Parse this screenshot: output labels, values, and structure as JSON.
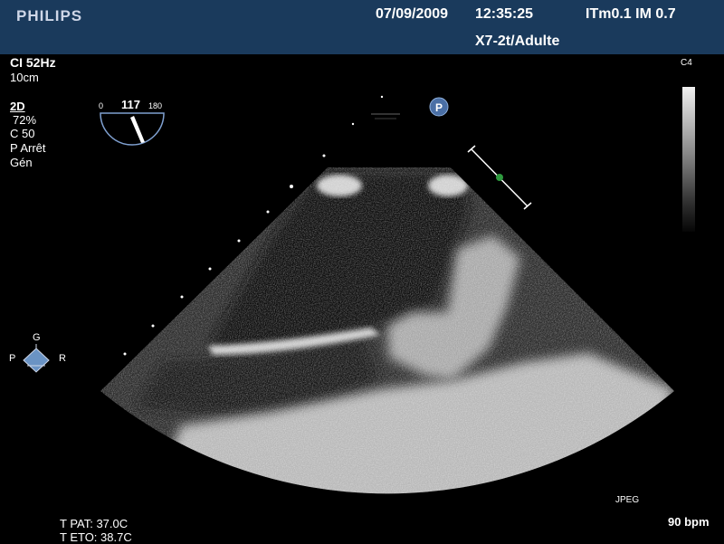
{
  "header": {
    "logo": "PHILIPS",
    "date": "07/09/2009",
    "time": "12:35:25",
    "index_values": "ITm0.1  IM 0.7",
    "probe_preset": "X7-2t/Adulte"
  },
  "left_panel": {
    "frame_rate": "CI 52Hz",
    "depth": "10cm",
    "mode": "2D",
    "gain": "72%",
    "compression": "C 50",
    "persistence": "P Arrêt",
    "frequency": "Gén"
  },
  "angle_indicator": {
    "min_label": "0",
    "max_label": "180",
    "value_label": "117",
    "angle_deg": 117
  },
  "p_marker": "P",
  "right_panel": {
    "colormap_label": "C4"
  },
  "orientation": {
    "top": "G",
    "left": "P",
    "right": "R"
  },
  "bottom": {
    "patient_temp": "T PAT: 37.0C",
    "probe_temp": "T ETO: 38.7C",
    "format": "JPEG",
    "heart_rate": "90 bpm"
  },
  "colors": {
    "header_bg": "#1a3a5c",
    "p_marker": "#4a6fa5",
    "focus_dot": "#2e9a3e"
  }
}
